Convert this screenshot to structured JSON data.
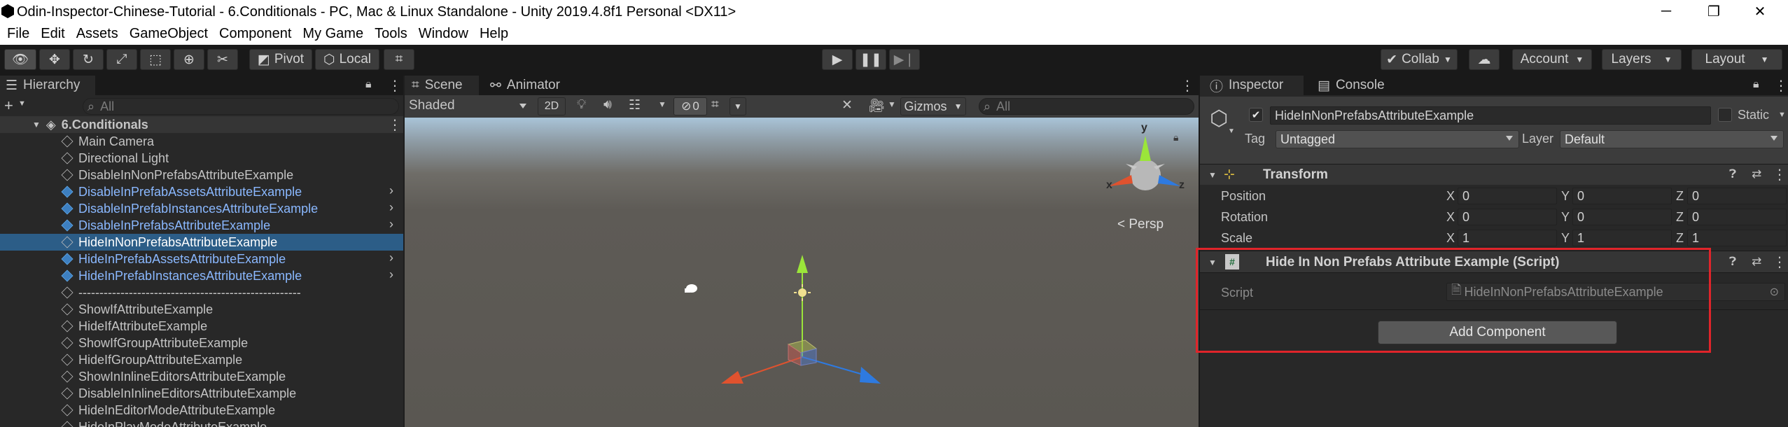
{
  "window": {
    "title": "Odin-Inspector-Chinese-Tutorial - 6.Conditionals - PC, Mac & Linux Standalone - Unity 2019.4.8f1 Personal <DX11>",
    "minimize": "─",
    "maximize": "❐",
    "close": "✕"
  },
  "menu": [
    "File",
    "Edit",
    "Assets",
    "GameObject",
    "Component",
    "My Game",
    "Tools",
    "Window",
    "Help"
  ],
  "toolbar": {
    "pivot": "Pivot",
    "local": "Local",
    "collab": "Collab",
    "account": "Account",
    "layers": "Layers",
    "layout": "Layout"
  },
  "hierarchy": {
    "tab": "Hierarchy",
    "search_placeholder": "All",
    "scene_name": "6.Conditionals",
    "items": [
      {
        "label": "Main Camera",
        "prefab": false,
        "arrow": false
      },
      {
        "label": "Directional Light",
        "prefab": false,
        "arrow": false
      },
      {
        "label": "DisableInNonPrefabsAttributeExample",
        "prefab": false,
        "arrow": false
      },
      {
        "label": "DisableInPrefabAssetsAttributeExample",
        "prefab": true,
        "arrow": true
      },
      {
        "label": "DisableInPrefabInstancesAttributeExample",
        "prefab": true,
        "arrow": true
      },
      {
        "label": "DisableInPrefabsAttributeExample",
        "prefab": true,
        "arrow": true
      },
      {
        "label": "HideInNonPrefabsAttributeExample",
        "prefab": false,
        "arrow": false,
        "selected": true
      },
      {
        "label": "HideInPrefabAssetsAttributeExample",
        "prefab": true,
        "arrow": true
      },
      {
        "label": "HideInPrefabInstancesAttributeExample",
        "prefab": true,
        "arrow": true
      },
      {
        "label": "-----------------------------------------------------",
        "prefab": false,
        "arrow": false
      },
      {
        "label": "ShowIfAttributeExample",
        "prefab": false,
        "arrow": false
      },
      {
        "label": "HideIfAttributeExample",
        "prefab": false,
        "arrow": false
      },
      {
        "label": "ShowIfGroupAttributeExample",
        "prefab": false,
        "arrow": false
      },
      {
        "label": "HideIfGroupAttributeExample",
        "prefab": false,
        "arrow": false
      },
      {
        "label": "ShowInInlineEditorsAttributeExample",
        "prefab": false,
        "arrow": false
      },
      {
        "label": "DisableInInlineEditorsAttributeExample",
        "prefab": false,
        "arrow": false
      },
      {
        "label": "HideInEditorModeAttributeExample",
        "prefab": false,
        "arrow": false
      },
      {
        "label": "HideInPlayModeAttributeExample",
        "prefab": false,
        "arrow": false
      }
    ]
  },
  "scene": {
    "tab_scene": "Scene",
    "tab_animator": "Animator",
    "shading": "Shaded",
    "mode_2d": "2D",
    "hidden_count": "0",
    "gizmos": "Gizmos",
    "search_placeholder": "All",
    "persp": "< Persp",
    "axis_x": "x",
    "axis_y": "y",
    "axis_z": "z"
  },
  "inspector": {
    "tab_inspector": "Inspector",
    "tab_console": "Console",
    "object_name": "HideInNonPrefabsAttributeExample",
    "static_label": "Static",
    "tag_label": "Tag",
    "tag_value": "Untagged",
    "layer_label": "Layer",
    "layer_value": "Default",
    "transform": {
      "title": "Transform",
      "position_label": "Position",
      "rotation_label": "Rotation",
      "scale_label": "Scale",
      "position": [
        "0",
        "0",
        "0"
      ],
      "rotation": [
        "0",
        "0",
        "0"
      ],
      "scale": [
        "1",
        "1",
        "1"
      ],
      "x": "X",
      "y": "Y",
      "z": "Z"
    },
    "script_component": {
      "title": "Hide In Non Prefabs Attribute Example (Script)",
      "script_label": "Script",
      "script_value": "HideInNonPrefabsAttributeExample"
    },
    "add_component": "Add Component",
    "highlight_color": "#e0242a"
  },
  "colors": {
    "selection": "#2c5d87",
    "prefab_text": "#8ab8ff",
    "panel": "#282828"
  }
}
